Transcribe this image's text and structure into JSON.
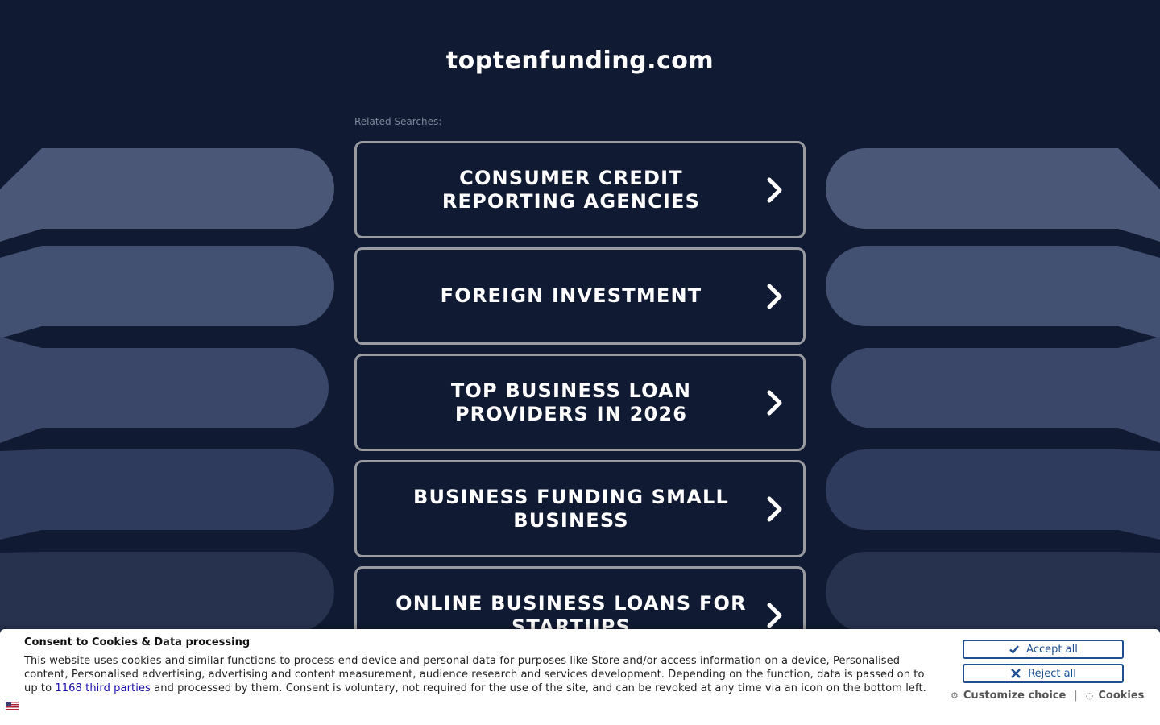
{
  "site": {
    "title": "toptenfunding.com"
  },
  "related": {
    "label": "Related Searches:",
    "items": [
      {
        "label": "Consumer Credit Reporting Agencies"
      },
      {
        "label": "Foreign Investment"
      },
      {
        "label": "Top Business Loan Providers in 2026"
      },
      {
        "label": "Business Funding Small Business"
      },
      {
        "label": "Online Business Loans for Startups"
      }
    ]
  },
  "consent": {
    "title": "Consent to Cookies & Data processing",
    "text_before": "This website uses cookies and similar functions to process end device and personal data for purposes like Store and/or access information on a device, Personalised content, Personalised advertising, advertising and content measurement, audience research and services development. Depending on the function, data is passed on to up to ",
    "link_text": "1168 third parties",
    "text_after": " and processed by them. Consent is voluntary, not required for the use of the site, and can be revoked at any time via an icon on the bottom left.",
    "accept_label": "Accept all",
    "reject_label": "Reject all",
    "customize_label": "Customize choice",
    "separator": "|",
    "cookies_label": "Cookies"
  },
  "icons": {
    "arrow": "chevron-right-icon",
    "accept": "check-icon",
    "reject": "x-icon",
    "customize": "gear-icon",
    "cookies": "cookie-icon",
    "language": "us-flag-icon"
  },
  "colors": {
    "background": "#111a33",
    "box_border": "#9a9ba0",
    "consent_button": "#1d4f91",
    "link": "#1a0dab"
  }
}
